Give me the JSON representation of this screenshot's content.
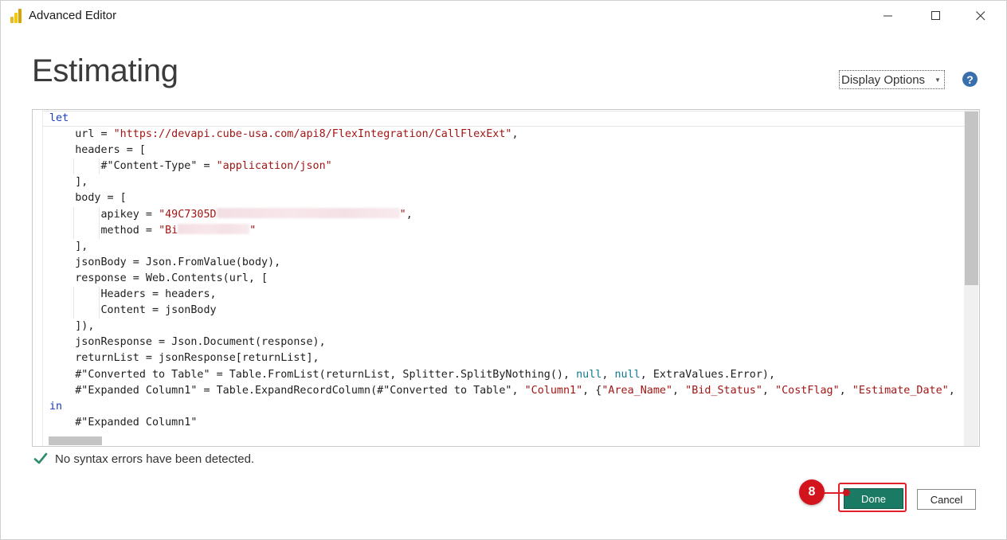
{
  "window": {
    "title": "Advanced Editor",
    "controls": {
      "minimize": "—",
      "maximize": "☐",
      "close": "✕"
    }
  },
  "heading": "Estimating",
  "toolbar": {
    "display_options_label": "Display Options",
    "help_label": "?"
  },
  "editor": {
    "lines": [
      [
        {
          "t": "let",
          "c": "kw"
        }
      ],
      [
        {
          "t": "    url = "
        },
        {
          "t": "\"https://devapi.cube-usa.com/api8/FlexIntegration/CallFlexExt\"",
          "c": "str"
        },
        {
          "t": ","
        }
      ],
      [
        {
          "t": "    headers = ["
        }
      ],
      [
        {
          "t": "        #\"Content-Type\" = "
        },
        {
          "t": "\"application/json\"",
          "c": "str"
        }
      ],
      [
        {
          "t": "    ],"
        }
      ],
      [
        {
          "t": "    body = ["
        }
      ],
      [
        {
          "t": "        apikey = "
        },
        {
          "t": "\"49C7305D",
          "c": "str"
        },
        {
          "t": "",
          "c": "blur",
          "w": 230
        },
        {
          "t": "\"",
          "c": "str"
        },
        {
          "t": ","
        }
      ],
      [
        {
          "t": "        method = "
        },
        {
          "t": "\"Bi",
          "c": "str"
        },
        {
          "t": "",
          "c": "blur",
          "w": 90
        },
        {
          "t": "\"",
          "c": "str"
        }
      ],
      [
        {
          "t": "    ],"
        }
      ],
      [
        {
          "t": "    jsonBody = Json.FromValue(body),"
        }
      ],
      [
        {
          "t": "    response = Web.Contents(url, ["
        }
      ],
      [
        {
          "t": "        Headers = headers,"
        }
      ],
      [
        {
          "t": "        Content = jsonBody"
        }
      ],
      [
        {
          "t": "    ]),"
        }
      ],
      [
        {
          "t": "    jsonResponse = Json.Document(response),"
        }
      ],
      [
        {
          "t": "    returnList = jsonResponse[returnList],"
        }
      ],
      [
        {
          "t": "    #\"Converted to Table\" = Table.FromList(returnList, Splitter.SplitByNothing(), "
        },
        {
          "t": "null",
          "c": "nul"
        },
        {
          "t": ", "
        },
        {
          "t": "null",
          "c": "nul"
        },
        {
          "t": ", ExtraValues.Error),"
        }
      ],
      [
        {
          "t": "    #\"Expanded Column1\" = Table.ExpandRecordColumn(#\"Converted to Table\", "
        },
        {
          "t": "\"Column1\"",
          "c": "str"
        },
        {
          "t": ", {"
        },
        {
          "t": "\"Area_Name\"",
          "c": "str"
        },
        {
          "t": ", "
        },
        {
          "t": "\"Bid_Status\"",
          "c": "str"
        },
        {
          "t": ", "
        },
        {
          "t": "\"CostFlag\"",
          "c": "str"
        },
        {
          "t": ", "
        },
        {
          "t": "\"Estimate_Date\"",
          "c": "str"
        },
        {
          "t": ","
        }
      ],
      [
        {
          "t": "in",
          "c": "kw"
        }
      ],
      [
        {
          "t": "    #\"Expanded Column1\""
        }
      ]
    ]
  },
  "status": {
    "message": "No syntax errors have been detected."
  },
  "actions": {
    "done_label": "Done",
    "cancel_label": "Cancel"
  },
  "annotation": {
    "step_number": "8"
  },
  "colors": {
    "keyword": "#1a3cc9",
    "string": "#a31515",
    "null_literal": "#117a8b",
    "done_button": "#1b7a64",
    "annotation_red": "#d3141d",
    "status_check": "#2e8b6e",
    "help_icon": "#3a6fad"
  }
}
